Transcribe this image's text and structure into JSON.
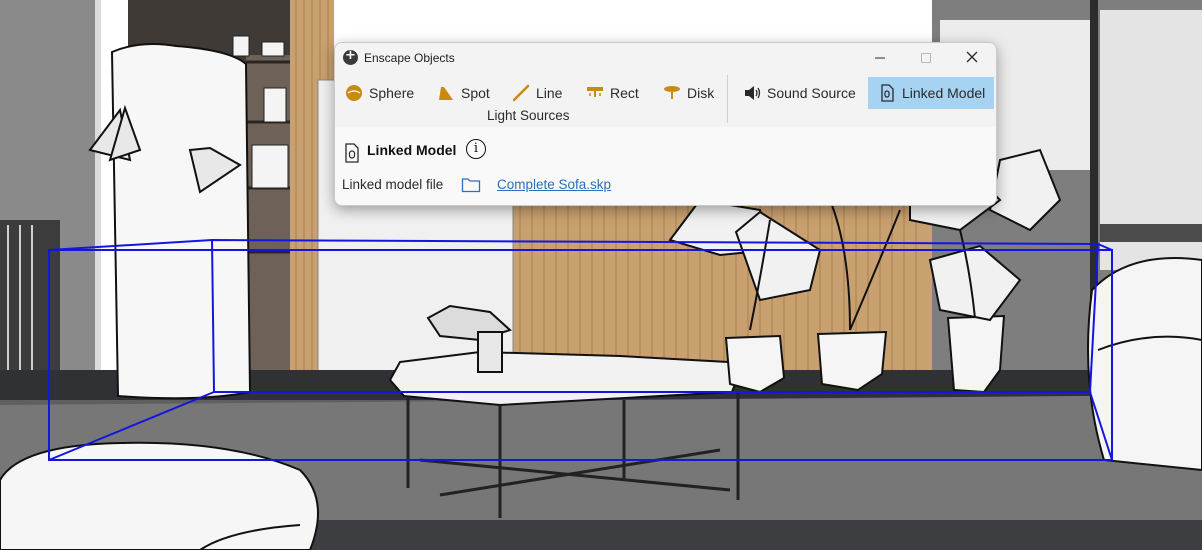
{
  "window": {
    "title": "Enscape Objects"
  },
  "window_controls": {
    "minimize": "—",
    "maximize": "☐",
    "close": "✕"
  },
  "toolbar": {
    "tools": [
      {
        "label": "Sphere",
        "icon": "sphere-light-icon"
      },
      {
        "label": "Spot",
        "icon": "spot-light-icon"
      },
      {
        "label": "Line",
        "icon": "line-light-icon"
      },
      {
        "label": "Rect",
        "icon": "rect-light-icon"
      },
      {
        "label": "Disk",
        "icon": "disk-light-icon"
      },
      {
        "label": "Sound Source",
        "icon": "speaker-icon"
      },
      {
        "label": "Linked Model",
        "icon": "linked-model-icon",
        "active": true
      }
    ],
    "group_label": "Light Sources"
  },
  "panel": {
    "title": "Linked Model",
    "info_icon": "i",
    "linked_model_file_label": "Linked model file",
    "file_name": "Complete Sofa.skp"
  },
  "colors": {
    "active_tool_bg": "#a7d3f3",
    "light_icon": "#c98a12",
    "link": "#2d6fb8",
    "bounding_box": "#1515e0"
  }
}
